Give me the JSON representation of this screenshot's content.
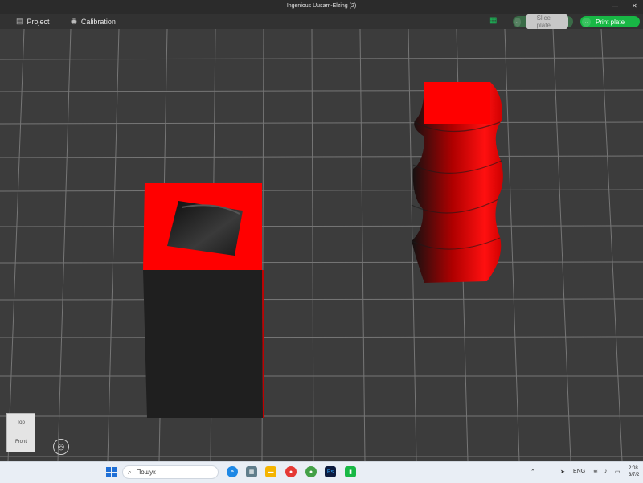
{
  "window": {
    "title": "Ingenious Uusam-Elzing (2)",
    "minimize_glyph": "—",
    "close_glyph": "✕"
  },
  "menubar": {
    "project_icon": "file-icon",
    "project_label": "Project",
    "calibration_icon": "calibration-icon",
    "calibration_label": "Calibration",
    "slice_label": "Slice plate",
    "print_label": "Print plate",
    "accent_color": "#18b845"
  },
  "toolbar": {
    "tools": [
      "add-object-icon",
      "arrange-grid-icon",
      "auto-orient-icon",
      "plate-layout-icon",
      "text-tool-icon",
      "assembly-view-icon"
    ]
  },
  "viewcube": {
    "top_label": "Top",
    "front_label": "Front"
  },
  "taskbar": {
    "search_placeholder": "Пошук",
    "language": "ENG",
    "time": "2:08",
    "date": "3/7/2"
  },
  "scene": {
    "model_color": "#ff0000",
    "shadow_color": "#1f1f1f",
    "grid_color": "#8a8a8a"
  }
}
